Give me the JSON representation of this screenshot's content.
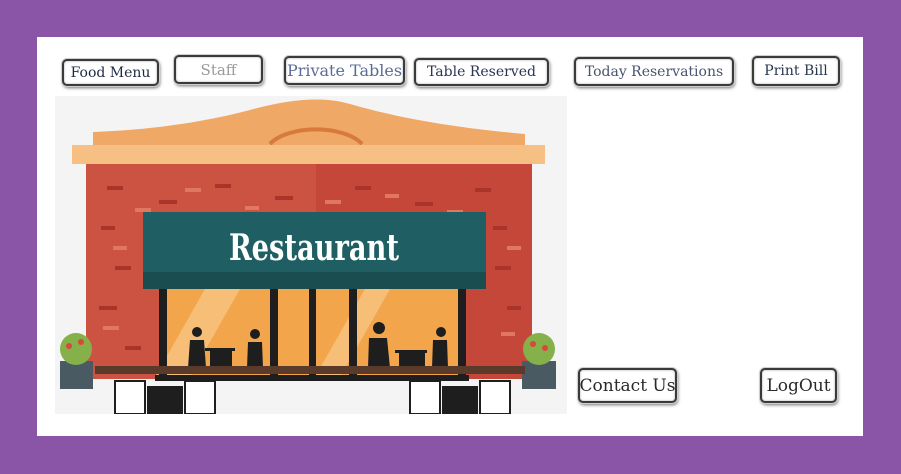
{
  "nav": {
    "food_menu": "Food Menu",
    "staff": "Staff",
    "private_tables": "Private Tables",
    "table_reserved": "Table Reserved",
    "today_reservations": "Today Reservations",
    "print_bill": "Print Bill"
  },
  "footer": {
    "contact_us": "Contact Us",
    "logout": "LogOut"
  },
  "illustration": {
    "sign_text": "Restaurant"
  },
  "colors": {
    "background": "#8a55a6",
    "panel": "#ffffff",
    "brick": "#c4473a",
    "roof": "#efa865",
    "sign": "#1f5e63",
    "window": "#f3a54c"
  }
}
